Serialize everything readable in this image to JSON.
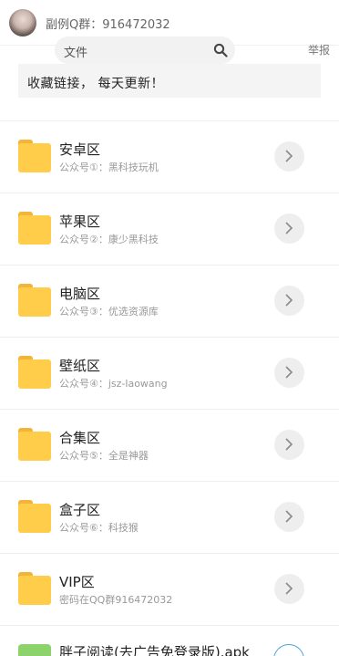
{
  "header": {
    "title": "副例Q群：916472032"
  },
  "search": {
    "label": "文件",
    "icon": "search-icon"
  },
  "report_label": "举报",
  "notice": "收藏链接， 每天更新！",
  "folders": [
    {
      "name": "安卓区",
      "subtitle": "公众号①：黑科技玩机"
    },
    {
      "name": "苹果区",
      "subtitle": "公众号②：康少黑科技"
    },
    {
      "name": "电脑区",
      "subtitle": "公众号③：优选资源库"
    },
    {
      "name": "壁纸区",
      "subtitle": "公众号④：jsz-laowang"
    },
    {
      "name": "合集区",
      "subtitle": "公众号⑤：全是神器"
    },
    {
      "name": "盒子区",
      "subtitle": "公众号⑥：科技猴"
    },
    {
      "name": "VIP区",
      "subtitle": "密码在QQ群916472032"
    }
  ],
  "file": {
    "name": "胖子阅读(去广告免登录版).apk"
  },
  "colors": {
    "folder": "#ffcd4a",
    "folder_tab": "#f2b53a",
    "apk": "#8bd36a",
    "download_ring": "#4aa3d8"
  }
}
